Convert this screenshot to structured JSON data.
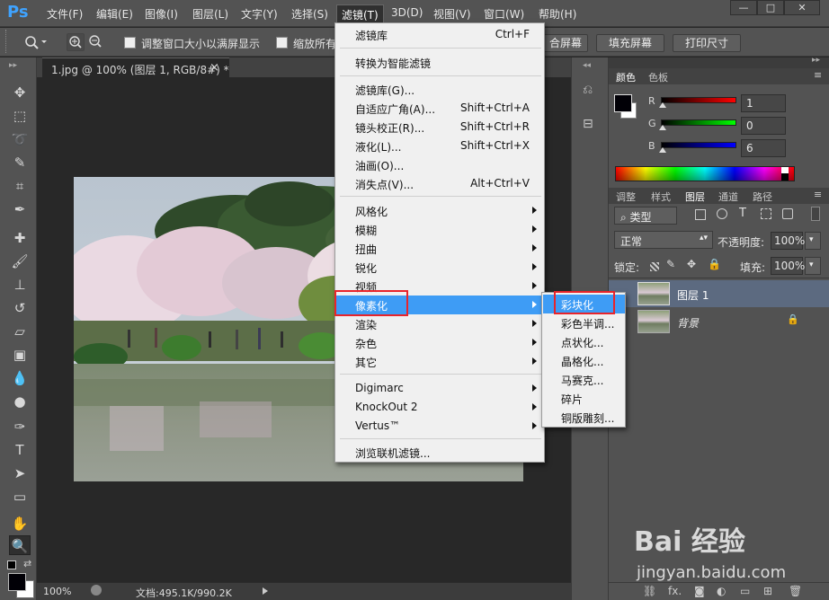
{
  "app": {
    "logo": "Ps",
    "menus": [
      "文件(F)",
      "编辑(E)",
      "图像(I)",
      "图层(L)",
      "文字(Y)",
      "选择(S)",
      "滤镜(T)",
      "3D(D)",
      "视图(V)",
      "窗口(W)",
      "帮助(H)"
    ],
    "window_controls": [
      "—",
      "□",
      "✕"
    ]
  },
  "options_bar": {
    "resize_windows_label": "调整窗口大小以满屏显示",
    "zoom_all_label": "缩放所有",
    "buttons": [
      "合屏幕",
      "填充屏幕",
      "打印尺寸"
    ]
  },
  "document": {
    "tab_title": "1.jpg @ 100% (图层 1, RGB/8#) *",
    "tab_close": "×",
    "zoom": "100%",
    "doc_info": "文档:495.1K/990.2K"
  },
  "filter_menu": {
    "items": [
      {
        "label": "滤镜库",
        "shortcut": "Ctrl+F"
      },
      {
        "label": "转换为智能滤镜"
      },
      {
        "label": "滤镜库(G)..."
      },
      {
        "label": "自适应广角(A)...",
        "shortcut": "Shift+Ctrl+A"
      },
      {
        "label": "镜头校正(R)...",
        "shortcut": "Shift+Ctrl+R"
      },
      {
        "label": "液化(L)...",
        "shortcut": "Shift+Ctrl+X"
      },
      {
        "label": "油画(O)..."
      },
      {
        "label": "消失点(V)...",
        "shortcut": "Alt+Ctrl+V"
      },
      {
        "label": "风格化"
      },
      {
        "label": "模糊"
      },
      {
        "label": "扭曲"
      },
      {
        "label": "锐化"
      },
      {
        "label": "视频"
      },
      {
        "label": "像素化"
      },
      {
        "label": "渲染"
      },
      {
        "label": "杂色"
      },
      {
        "label": "其它"
      },
      {
        "label": "Digimarc"
      },
      {
        "label": "KnockOut 2"
      },
      {
        "label": "Vertus™"
      },
      {
        "label": "浏览联机滤镜..."
      }
    ],
    "highlighted": "像素化"
  },
  "pixelate_submenu": {
    "items": [
      "彩块化",
      "彩色半调...",
      "点状化...",
      "晶格化...",
      "马赛克...",
      "碎片",
      "铜版雕刻..."
    ],
    "highlighted": "彩块化"
  },
  "color_panel": {
    "tabs": [
      "颜色",
      "色板"
    ],
    "channels": [
      {
        "name": "R",
        "value": "1",
        "gradient": "linear-gradient(to right,#000,#f00)"
      },
      {
        "name": "G",
        "value": "0",
        "gradient": "linear-gradient(to right,#000,#0f0)"
      },
      {
        "name": "B",
        "value": "6",
        "gradient": "linear-gradient(to right,#000,#00f)"
      }
    ],
    "foreground": "#010006"
  },
  "layers_panel": {
    "tabs": [
      "调整",
      "样式",
      "图层",
      "通道",
      "路径"
    ],
    "filter_type": "类型",
    "filter_icons": [
      "T"
    ],
    "blend_mode": "正常",
    "opacity_label": "不透明度:",
    "opacity": "100%",
    "lock_label": "锁定:",
    "fill_label": "填充:",
    "fill": "100%",
    "layers": [
      {
        "name": "图层 1",
        "selected": true
      },
      {
        "name": "背景",
        "selected": false,
        "locked": true
      }
    ],
    "bottom_icons": [
      "fx."
    ]
  },
  "watermark": {
    "logo": "Bai 经验",
    "url": "jingyan.baidu.com"
  },
  "colors": {
    "accent": "#3e9cf5",
    "annotation_red": "#e8242b",
    "panel_bg": "#535353",
    "canvas_bg": "#282828"
  }
}
